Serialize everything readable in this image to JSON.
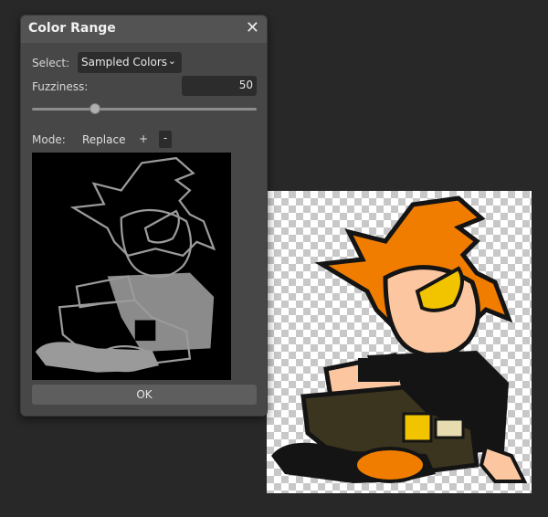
{
  "dialog": {
    "title": "Color Range",
    "close_glyph": "✕",
    "select_label": "Select:",
    "select_value": "Sampled Colors",
    "fuzziness_label": "Fuzziness:",
    "fuzziness_value": "50",
    "fuzziness_level": 0.28,
    "mode_label": "Mode:",
    "mode_replace": "Replace",
    "mode_add": "+",
    "mode_subtract": "-",
    "ok_label": "OK"
  },
  "colors": {
    "background": "#282828",
    "dialog": "#474747",
    "field": "#2c2c2c",
    "art_orange": "#f07d00",
    "art_black": "#141414",
    "art_skin": "#fcc7a0",
    "art_yellow": "#f2c400",
    "art_olive": "#3b3520",
    "mask_gray": "#9a9a9a"
  },
  "icons": {
    "close": "close-icon",
    "dropdown": "chevron-down-icon"
  }
}
